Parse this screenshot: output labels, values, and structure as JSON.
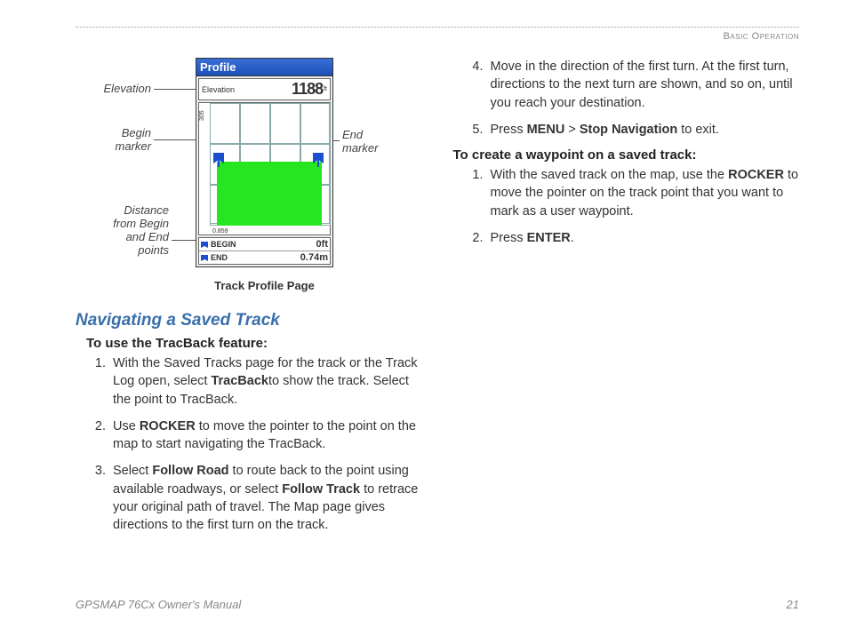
{
  "header": {
    "section": "Basic Operation"
  },
  "figure": {
    "labels": {
      "elevation": "Elevation",
      "begin_marker": "Begin\nmarker",
      "end_marker": "End\nmarker",
      "distance": "Distance\nfrom Begin\nand End\npoints"
    },
    "device": {
      "title": "Profile",
      "elev_label": "Elevation",
      "elev_value": "1188",
      "elev_unit": "ft",
      "axis_tick": "305",
      "scale_tick": "0.859",
      "begin_label": "BEGIN",
      "begin_value": "0ft",
      "end_label": "END",
      "end_value": "0.74m"
    },
    "caption": "Track Profile Page"
  },
  "left": {
    "heading": "Navigating a Saved Track",
    "subheading": "To use the TracBack feature:",
    "steps": {
      "s1a": "With the Saved Tracks page for the track or the Track Log open, select ",
      "s1b": "TracBack",
      "s1c": "to show the track. Select the point to TracBack.",
      "s2a": "Use ",
      "s2b": "ROCKER",
      "s2c": " to move the pointer to the point on the map to start navigating the TracBack.",
      "s3a": "Select ",
      "s3b": "Follow Road",
      "s3c": " to route back to the point using available roadways, or select ",
      "s3d": "Follow Track",
      "s3e": " to retrace your original path of travel. The Map page gives directions to the first turn on the track."
    }
  },
  "right": {
    "steps_cont": {
      "s4": "Move in the direction of the first turn. At the first turn, directions to the next turn are shown, and so on, until you reach your destination.",
      "s5a": "Press ",
      "s5b": "MENU",
      "s5c": " > ",
      "s5d": "Stop Navigation",
      "s5e": " to exit."
    },
    "subheading": "To create a waypoint on a saved track:",
    "steps2": {
      "s1a": "With the saved track on the map, use the ",
      "s1b": "ROCKER",
      "s1c": " to move the pointer on the track point that you want to mark as a user waypoint.",
      "s2a": "Press ",
      "s2b": "ENTER",
      "s2c": "."
    }
  },
  "footer": {
    "left": "GPSMAP 76Cx Owner's Manual",
    "right": "21"
  },
  "chart_data": {
    "type": "area",
    "title": "Track Profile Page",
    "xlabel": "Distance",
    "ylabel": "Elevation (ft)",
    "current_elevation_ft": 1188,
    "y_tick_ft": 305,
    "x_tick_mi": 0.859,
    "series": [
      {
        "name": "track elevation",
        "approx_profile": "flat at ~305 ft from BEGIN to END with markers at both ends"
      }
    ],
    "markers": {
      "BEGIN": {
        "distance": "0 ft"
      },
      "END": {
        "distance": "0.74 mi"
      }
    }
  }
}
